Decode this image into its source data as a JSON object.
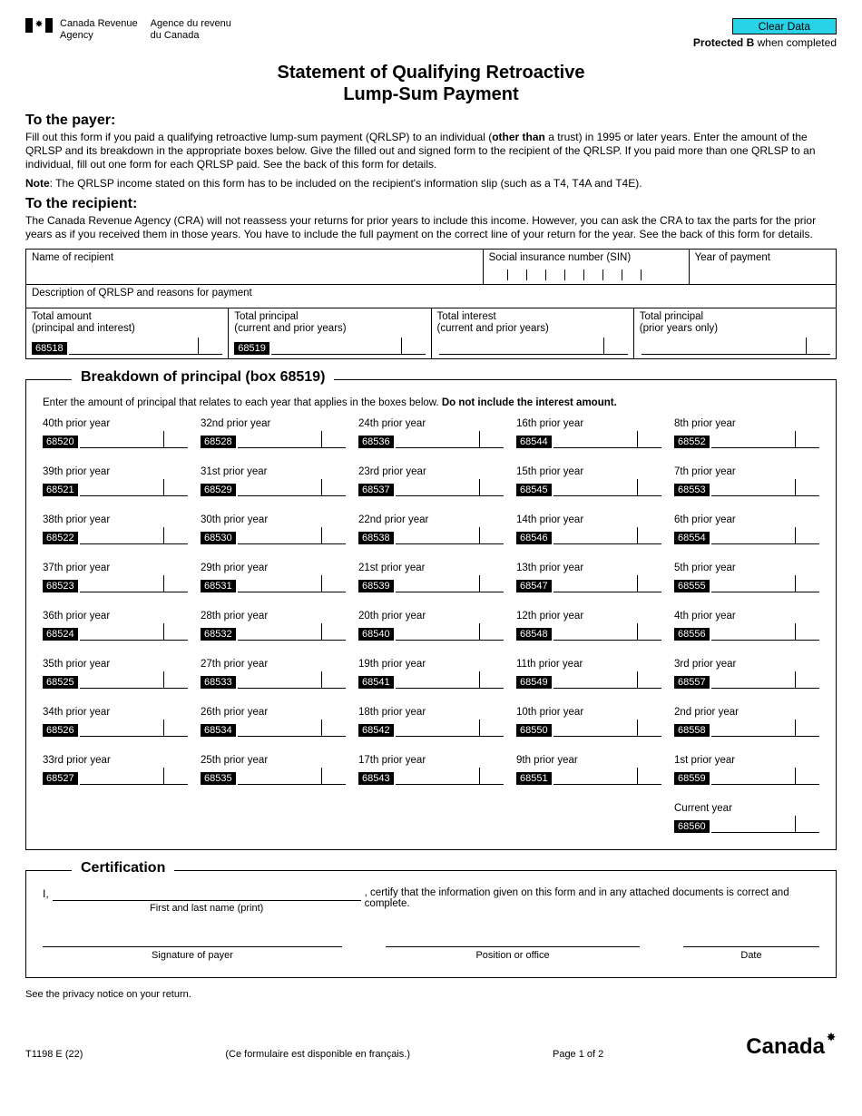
{
  "header": {
    "agency_en_line1": "Canada Revenue",
    "agency_en_line2": "Agency",
    "agency_fr_line1": "Agence du revenu",
    "agency_fr_line2": "du Canada",
    "clear_data": "Clear Data",
    "protected_bold": "Protected B",
    "protected_rest": " when completed"
  },
  "title_line1": "Statement of Qualifying Retroactive",
  "title_line2": "Lump-Sum Payment",
  "payer": {
    "heading": "To the payer:",
    "p1a": "Fill out this form if you paid a qualifying retroactive lump-sum payment (QRLSP) to an individual (",
    "p1b": "other than",
    "p1c": " a trust) in 1995 or later years. Enter the amount of the QRLSP and its breakdown in the appropriate boxes below. Give the filled out and signed form to the recipient of the QRLSP. If you paid more than one QRLSP to an individual, fill out one form for each QRLSP paid. See the back of this form for details.",
    "note_label": "Note",
    "note_text": ": The QRLSP income stated on this form has to be included on the recipient's information slip (such as a T4, T4A and T4E)."
  },
  "recipient": {
    "heading": "To the recipient:",
    "p1": "The Canada Revenue Agency (CRA) will not reassess your returns for prior years to include this income. However, you can ask the CRA to tax the parts for the prior years as if you received them in those years. You have to include the full payment on the correct line of your return for the year. See the back of this form for details."
  },
  "fields": {
    "name_label": "Name of recipient",
    "sin_label": "Social insurance number (SIN)",
    "year_label": "Year of payment",
    "desc_label": "Description of QRLSP and reasons for payment",
    "totals": [
      {
        "label1": "Total amount",
        "label2": "(principal and interest)",
        "code": "68518"
      },
      {
        "label1": "Total principal",
        "label2": "(current and prior years)",
        "code": "68519"
      },
      {
        "label1": "Total interest",
        "label2": "(current and prior years)",
        "code": ""
      },
      {
        "label1": "Total principal",
        "label2": "(prior years only)",
        "code": ""
      }
    ]
  },
  "breakdown": {
    "legend": "Breakdown of principal (box 68519)",
    "intro_a": "Enter the amount of principal that relates to each year that applies in the boxes below. ",
    "intro_b": "Do not include the interest amount.",
    "columns": [
      [
        {
          "label": "40th prior year",
          "code": "68520"
        },
        {
          "label": "39th prior year",
          "code": "68521"
        },
        {
          "label": "38th prior year",
          "code": "68522"
        },
        {
          "label": "37th prior year",
          "code": "68523"
        },
        {
          "label": "36th prior year",
          "code": "68524"
        },
        {
          "label": "35th prior year",
          "code": "68525"
        },
        {
          "label": "34th prior year",
          "code": "68526"
        },
        {
          "label": "33rd prior year",
          "code": "68527"
        }
      ],
      [
        {
          "label": "32nd prior year",
          "code": "68528"
        },
        {
          "label": "31st prior year",
          "code": "68529"
        },
        {
          "label": "30th prior year",
          "code": "68530"
        },
        {
          "label": "29th prior year",
          "code": "68531"
        },
        {
          "label": "28th prior year",
          "code": "68532"
        },
        {
          "label": "27th prior year",
          "code": "68533"
        },
        {
          "label": "26th prior year",
          "code": "68534"
        },
        {
          "label": "25th prior year",
          "code": "68535"
        }
      ],
      [
        {
          "label": "24th prior year",
          "code": "68536"
        },
        {
          "label": "23rd prior year",
          "code": "68537"
        },
        {
          "label": "22nd prior year",
          "code": "68538"
        },
        {
          "label": "21st prior year",
          "code": "68539"
        },
        {
          "label": "20th prior year",
          "code": "68540"
        },
        {
          "label": "19th prior year",
          "code": "68541"
        },
        {
          "label": "18th prior year",
          "code": "68542"
        },
        {
          "label": "17th prior year",
          "code": "68543"
        }
      ],
      [
        {
          "label": "16th prior year",
          "code": "68544"
        },
        {
          "label": "15th prior year",
          "code": "68545"
        },
        {
          "label": "14th prior year",
          "code": "68546"
        },
        {
          "label": "13th prior year",
          "code": "68547"
        },
        {
          "label": "12th prior year",
          "code": "68548"
        },
        {
          "label": "11th prior year",
          "code": "68549"
        },
        {
          "label": "10th prior year",
          "code": "68550"
        },
        {
          "label": "9th prior year",
          "code": "68551"
        }
      ],
      [
        {
          "label": "8th prior year",
          "code": "68552"
        },
        {
          "label": "7th prior year",
          "code": "68553"
        },
        {
          "label": "6th prior year",
          "code": "68554"
        },
        {
          "label": "5th prior year",
          "code": "68555"
        },
        {
          "label": "4th prior year",
          "code": "68556"
        },
        {
          "label": "3rd prior year",
          "code": "68557"
        },
        {
          "label": "2nd prior year",
          "code": "68558"
        },
        {
          "label": "1st prior year",
          "code": "68559"
        }
      ]
    ],
    "current": {
      "label": "Current year",
      "code": "68560"
    }
  },
  "certification": {
    "legend": "Certification",
    "i": "I,",
    "name_caption": "First and last name (print)",
    "text": ", certify that the information given on this form and in any attached documents is correct and complete.",
    "sig_caption": "Signature of payer",
    "pos_caption": "Position or office",
    "date_caption": "Date"
  },
  "privacy": "See the privacy notice on your return.",
  "footer": {
    "form_code": "T1198 E (22)",
    "french_note": "(Ce formulaire est disponible en français.)",
    "page": "Page 1 of 2",
    "wordmark": "Canada"
  }
}
